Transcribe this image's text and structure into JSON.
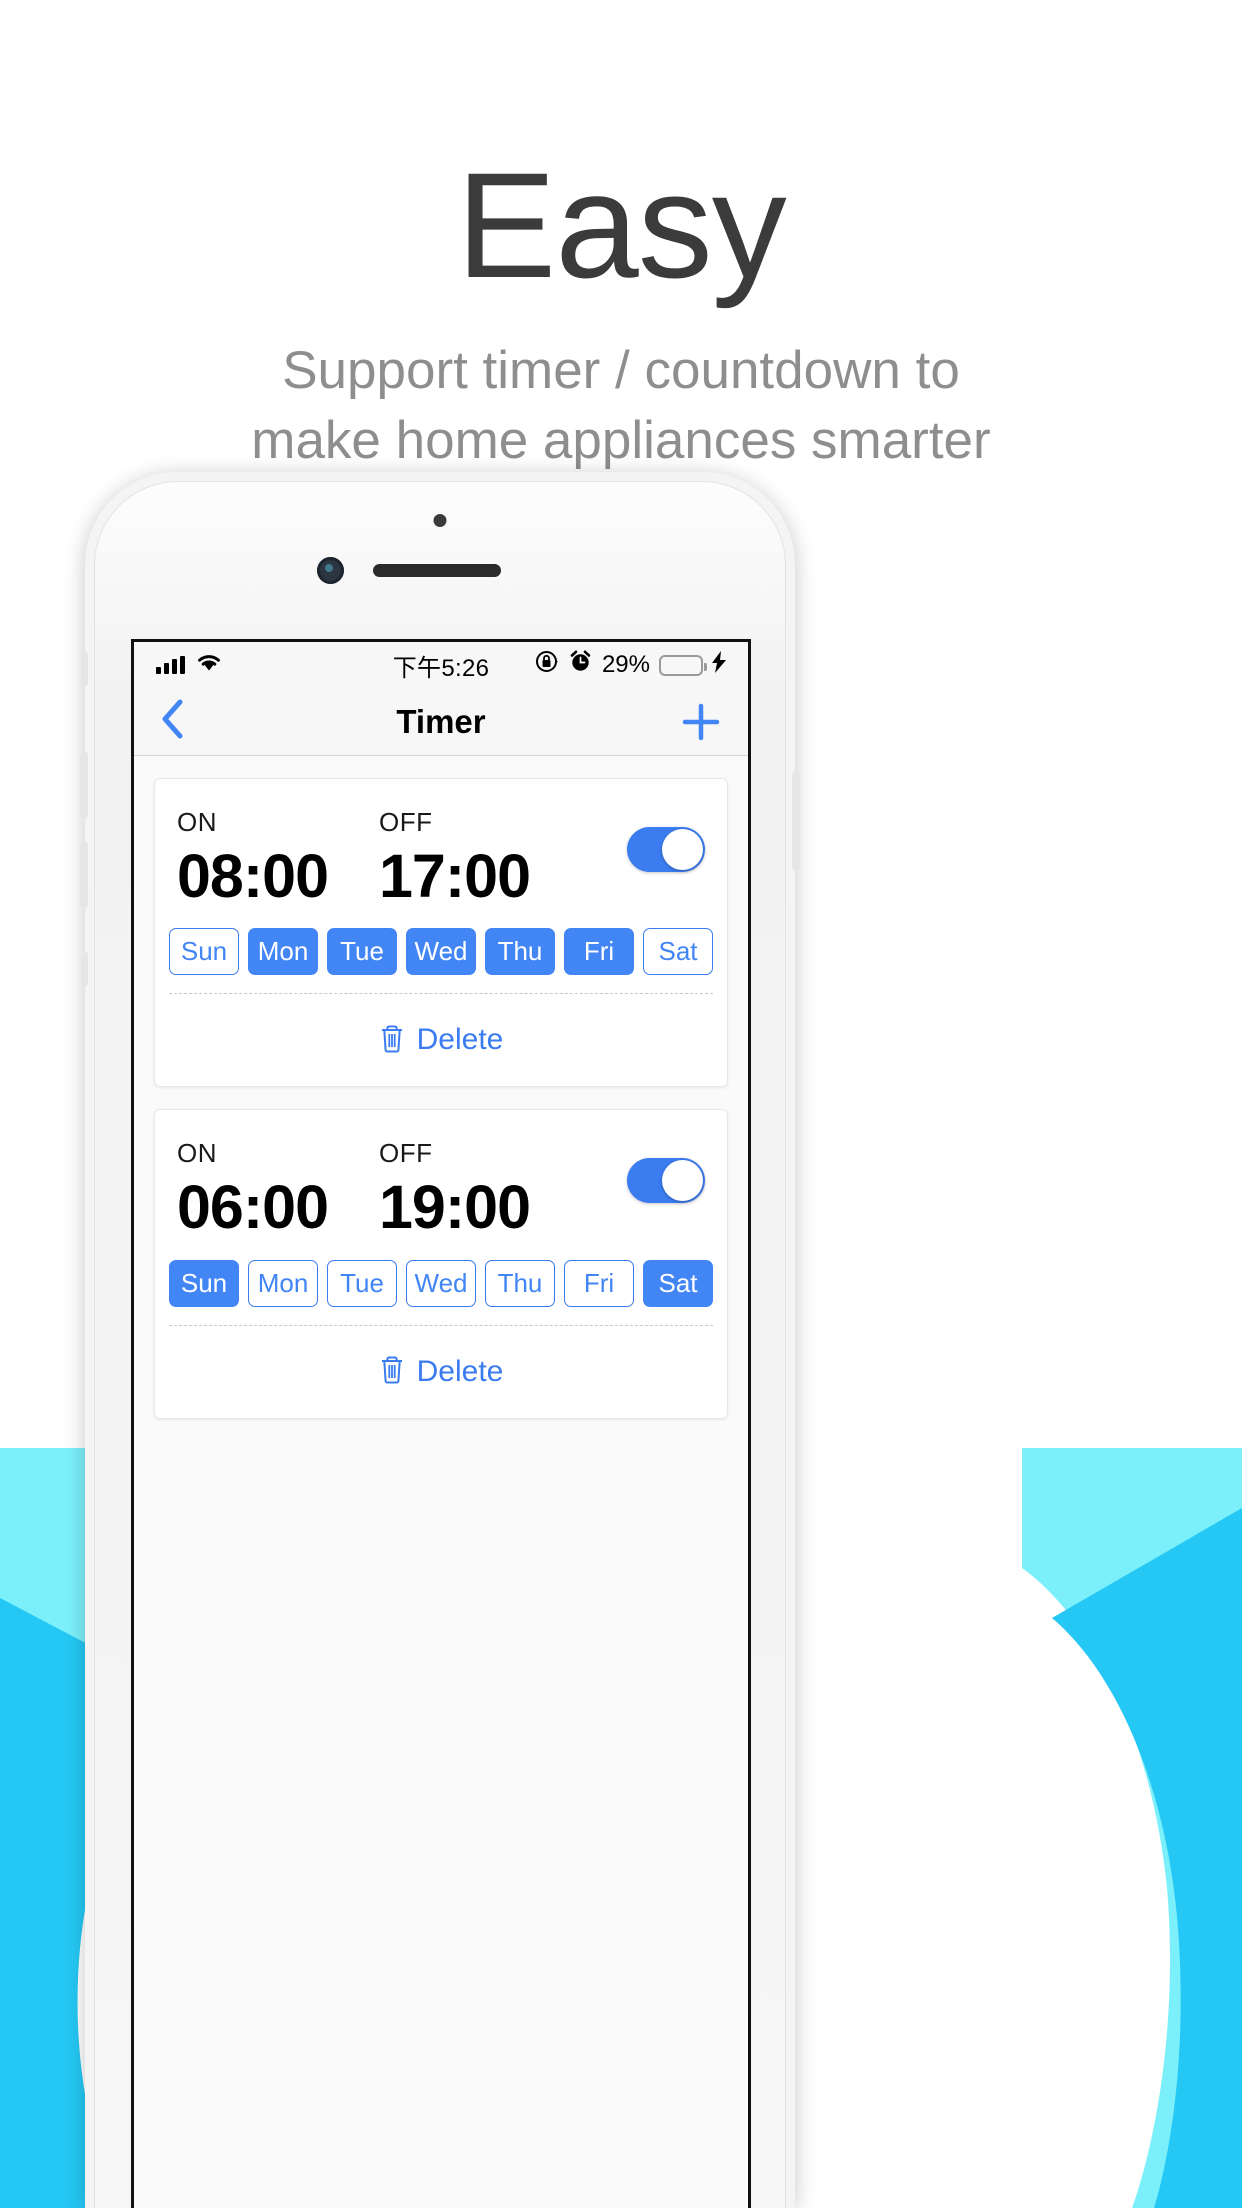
{
  "hero": {
    "title": "Easy",
    "subtitle_line1": "Support timer / countdown to",
    "subtitle_line2": "make home appliances smarter"
  },
  "statusbar": {
    "signal_icon": "signal-bars-icon",
    "wifi_icon": "wifi-icon",
    "time": "下午5:26",
    "rotation_lock_icon": "rotation-lock-icon",
    "alarm_icon": "alarm-clock-icon",
    "battery_percent": "29%",
    "battery_level": 29,
    "battery_color": "#4cd964",
    "charging_icon": "lightning-bolt-icon"
  },
  "navbar": {
    "back_icon": "chevron-left-icon",
    "title": "Timer",
    "add_icon": "plus-icon"
  },
  "theme": {
    "accent": "#4285f4",
    "accent_dark": "#3b7cf0",
    "screen_bg": "#fafafa"
  },
  "timers": [
    {
      "on_label": "ON",
      "on_time": "08:00",
      "off_label": "OFF",
      "off_time": "17:00",
      "enabled": true,
      "days": [
        {
          "label": "Sun",
          "selected": false
        },
        {
          "label": "Mon",
          "selected": true
        },
        {
          "label": "Tue",
          "selected": true
        },
        {
          "label": "Wed",
          "selected": true
        },
        {
          "label": "Thu",
          "selected": true
        },
        {
          "label": "Fri",
          "selected": true
        },
        {
          "label": "Sat",
          "selected": false
        }
      ],
      "delete_label": "Delete",
      "delete_icon": "trash-icon"
    },
    {
      "on_label": "ON",
      "on_time": "06:00",
      "off_label": "OFF",
      "off_time": "19:00",
      "enabled": true,
      "days": [
        {
          "label": "Sun",
          "selected": true
        },
        {
          "label": "Mon",
          "selected": false
        },
        {
          "label": "Tue",
          "selected": false
        },
        {
          "label": "Wed",
          "selected": false
        },
        {
          "label": "Thu",
          "selected": false
        },
        {
          "label": "Fri",
          "selected": false
        },
        {
          "label": "Sat",
          "selected": true
        }
      ],
      "delete_label": "Delete",
      "delete_icon": "trash-icon"
    }
  ]
}
